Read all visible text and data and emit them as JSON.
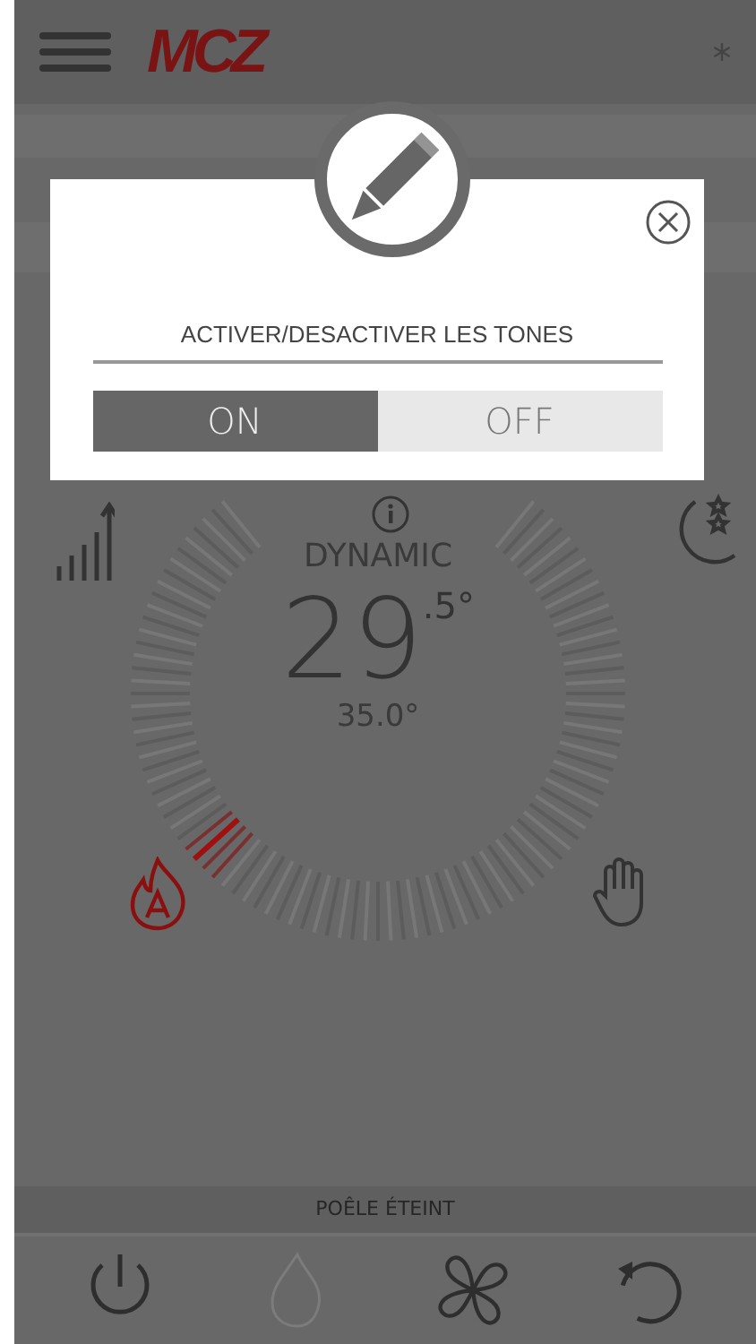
{
  "header": {
    "logo": "MCZ"
  },
  "dialog": {
    "title": "ACTIVER/DESACTIVER LES TONES",
    "options": [
      {
        "label": "ON",
        "selected": true
      },
      {
        "label": "OFF",
        "selected": false
      }
    ]
  },
  "thermostat": {
    "mode": "DYNAMIC",
    "temperature": "29",
    "temperature_decimal": ".5°",
    "setpoint": "35.0°"
  },
  "status_bar": "POÊLE ÉTEINT",
  "bottom_buttons": [
    {
      "kind": "power",
      "disabled": false
    },
    {
      "kind": "flame",
      "disabled": true
    },
    {
      "kind": "fan",
      "disabled": false
    },
    {
      "kind": "reset",
      "disabled": false
    }
  ]
}
